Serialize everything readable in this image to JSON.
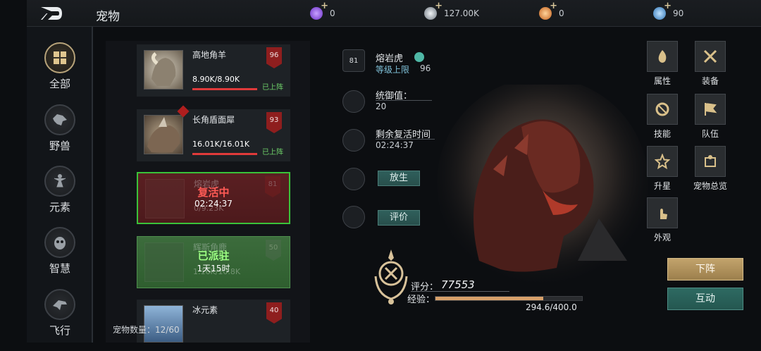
{
  "header": {
    "title": "宠物",
    "resources": [
      {
        "icon": "purple-gem-icon",
        "value": "0",
        "color": "#8a4fd9"
      },
      {
        "icon": "silver-coin-icon",
        "value": "127.00K",
        "color": "#b9c3cc"
      },
      {
        "icon": "orange-orb-icon",
        "value": "0",
        "color": "#e08a3c"
      },
      {
        "icon": "blue-crystal-icon",
        "value": "90",
        "color": "#5aa6e0"
      }
    ]
  },
  "nav": [
    {
      "label": "全部",
      "icon": "grid-icon",
      "active": true
    },
    {
      "label": "野兽",
      "icon": "beast-head-icon"
    },
    {
      "label": "元素",
      "icon": "fairy-icon"
    },
    {
      "label": "智慧",
      "icon": "owl-icon"
    },
    {
      "label": "飞行",
      "icon": "eagle-icon"
    }
  ],
  "pets": [
    {
      "name": "高地角羊",
      "hp": "8.90K/8.90K",
      "level": "96",
      "status": "已上阵"
    },
    {
      "name": "长角盾面犀",
      "hp": "16.01K/16.01K",
      "level": "93",
      "status": "已上阵"
    },
    {
      "name": "熔岩虎",
      "hp": "0/9.23K",
      "level": "81",
      "overlay": "复活中",
      "timer": "02:24:37"
    },
    {
      "name": "辉斯角鹿",
      "hp": "1.16K/10.8K",
      "level": "50",
      "overlay": "已派驻",
      "timer": "1天15时"
    },
    {
      "name": "冰元素",
      "level": "40"
    }
  ],
  "pet_count_label": "宠物数量：",
  "pet_count": "12/60",
  "detail": {
    "level_badge": "81",
    "name": "熔岩虎",
    "level_cap_label": "等级上限",
    "level_cap": "96",
    "command_label": "统御值：",
    "command_value": "20",
    "revive_label": "剩余复活时间",
    "revive_time": "02:24:37",
    "release_btn": "放生",
    "review_btn": "评价",
    "score_label": "评分：",
    "score_value": "77553",
    "exp_label": "经验：",
    "exp_value": "294.6/400.0",
    "exp_progress": 0.7365
  },
  "right_menu": [
    {
      "label": "属性",
      "icon": "flame-icon"
    },
    {
      "label": "装备",
      "icon": "crossed-swords-icon"
    },
    {
      "label": "技能",
      "icon": "skill-ring-icon"
    },
    {
      "label": "队伍",
      "icon": "flag-icon"
    },
    {
      "label": "升星",
      "icon": "star-icon"
    },
    {
      "label": "宠物总览",
      "icon": "overview-icon"
    },
    {
      "label": "外观",
      "icon": "hand-icon"
    }
  ],
  "actions": {
    "dismiss": "下阵",
    "interact": "互动"
  }
}
